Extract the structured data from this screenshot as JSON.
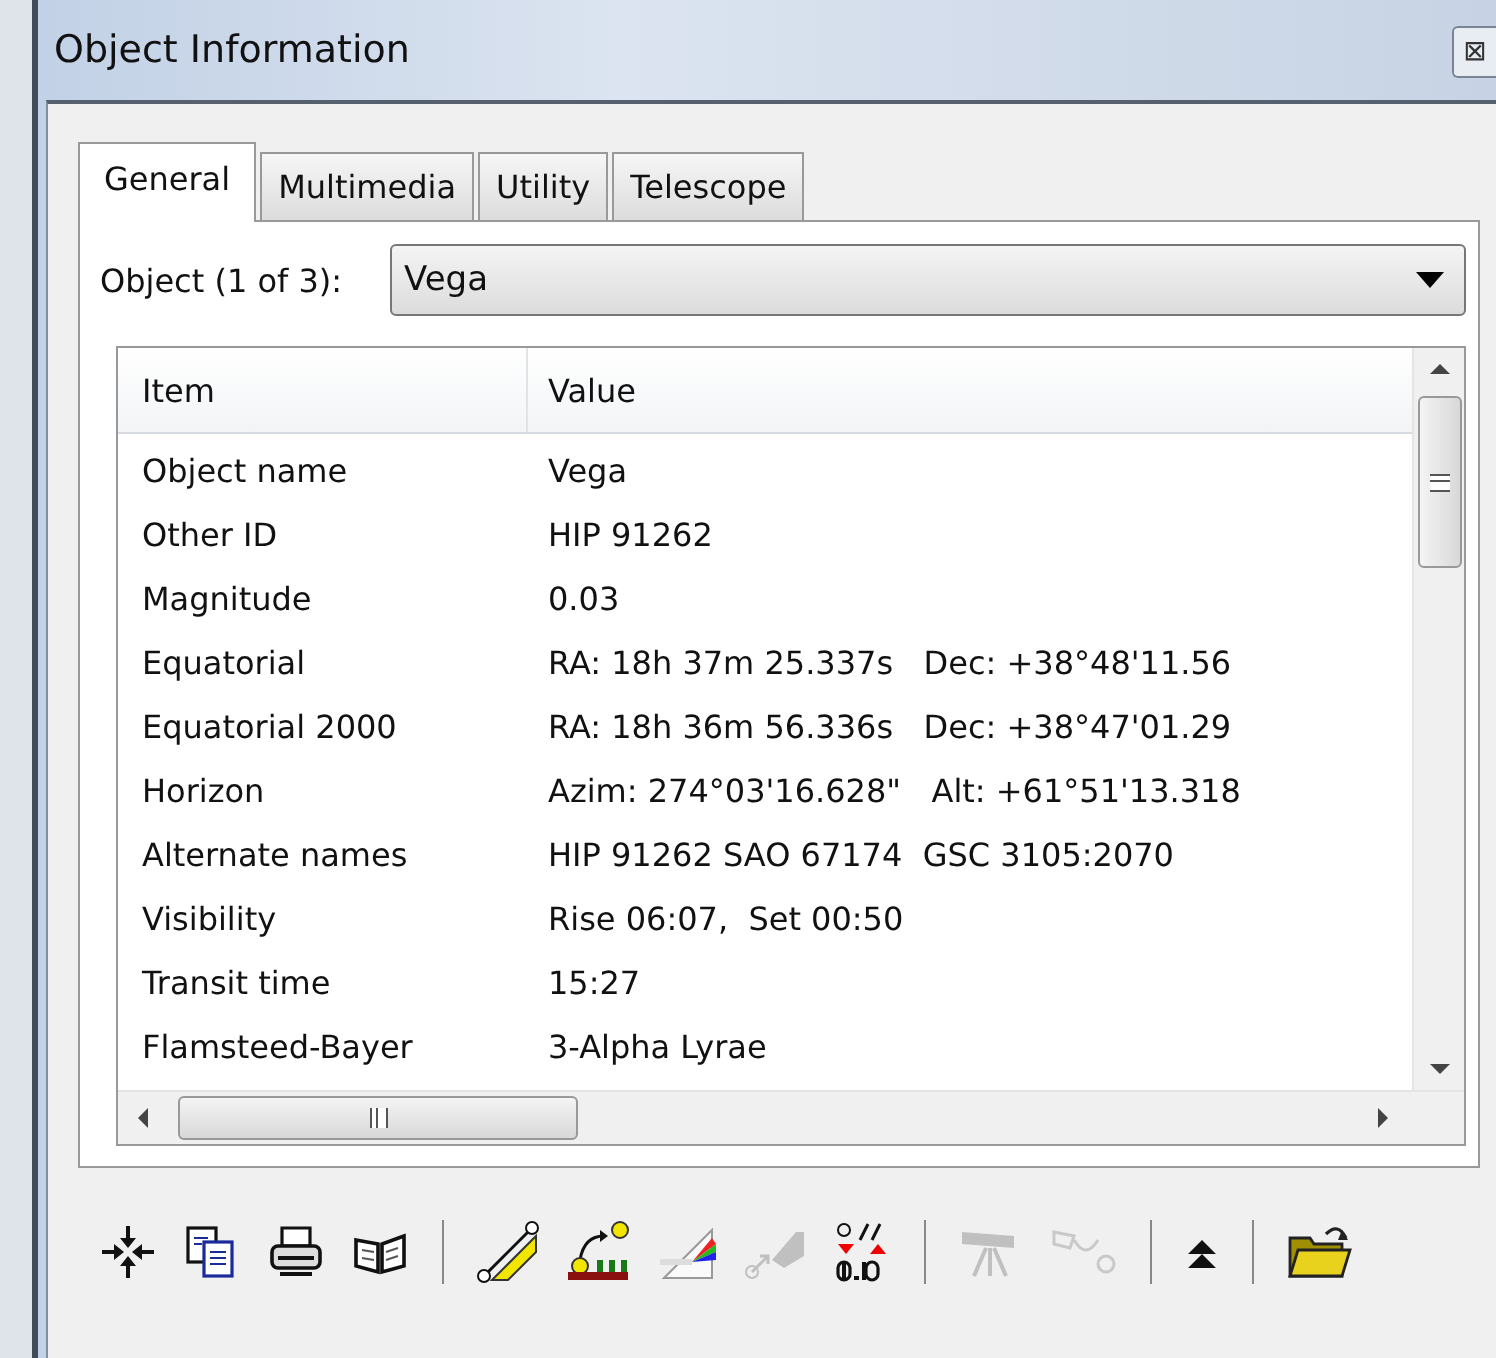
{
  "window": {
    "title": "Object Information",
    "close": "⊠"
  },
  "tabs": [
    {
      "label": "General",
      "selected": true
    },
    {
      "label": "Multimedia",
      "selected": false
    },
    {
      "label": "Utility",
      "selected": false
    },
    {
      "label": "Telescope",
      "selected": false
    }
  ],
  "object_select": {
    "label": "Object (1 of 3):",
    "value": "Vega"
  },
  "table": {
    "columns": [
      "Item",
      "Value"
    ],
    "rows": [
      {
        "item": "Object name",
        "value": "Vega"
      },
      {
        "item": "Other ID",
        "value": "HIP 91262"
      },
      {
        "item": "Magnitude",
        "value": "0.03"
      },
      {
        "item": "Equatorial",
        "value": "RA: 18h 37m 25.337s   Dec: +38°48'11.56"
      },
      {
        "item": "Equatorial 2000",
        "value": "RA: 18h 36m 56.336s   Dec: +38°47'01.29"
      },
      {
        "item": "Horizon",
        "value": "Azim: 274°03'16.628\"   Alt: +61°51'13.318"
      },
      {
        "item": "Alternate names",
        "value": "HIP 91262 SAO 67174  GSC 3105:2070"
      },
      {
        "item": "Visibility",
        "value": "Rise 06:07,  Set 00:50"
      },
      {
        "item": "Transit time",
        "value": "15:27"
      },
      {
        "item": "Flamsteed-Bayer",
        "value": "3-Alpha Lyrae"
      }
    ]
  },
  "toolbar": [
    [
      {
        "kind": "center",
        "disabled": false
      },
      {
        "kind": "copy",
        "disabled": false
      },
      {
        "kind": "print",
        "disabled": false
      },
      {
        "kind": "book",
        "disabled": false
      }
    ],
    [
      {
        "kind": "ruler",
        "disabled": false
      },
      {
        "kind": "rise",
        "disabled": false
      },
      {
        "kind": "prism",
        "disabled": false
      },
      {
        "kind": "slew",
        "disabled": true
      },
      {
        "kind": "offset",
        "disabled": false
      }
    ],
    [
      {
        "kind": "telescope",
        "disabled": true
      },
      {
        "kind": "sync",
        "disabled": true
      }
    ],
    [
      {
        "kind": "up",
        "disabled": false
      }
    ],
    [
      {
        "kind": "folder",
        "disabled": false
      }
    ]
  ]
}
